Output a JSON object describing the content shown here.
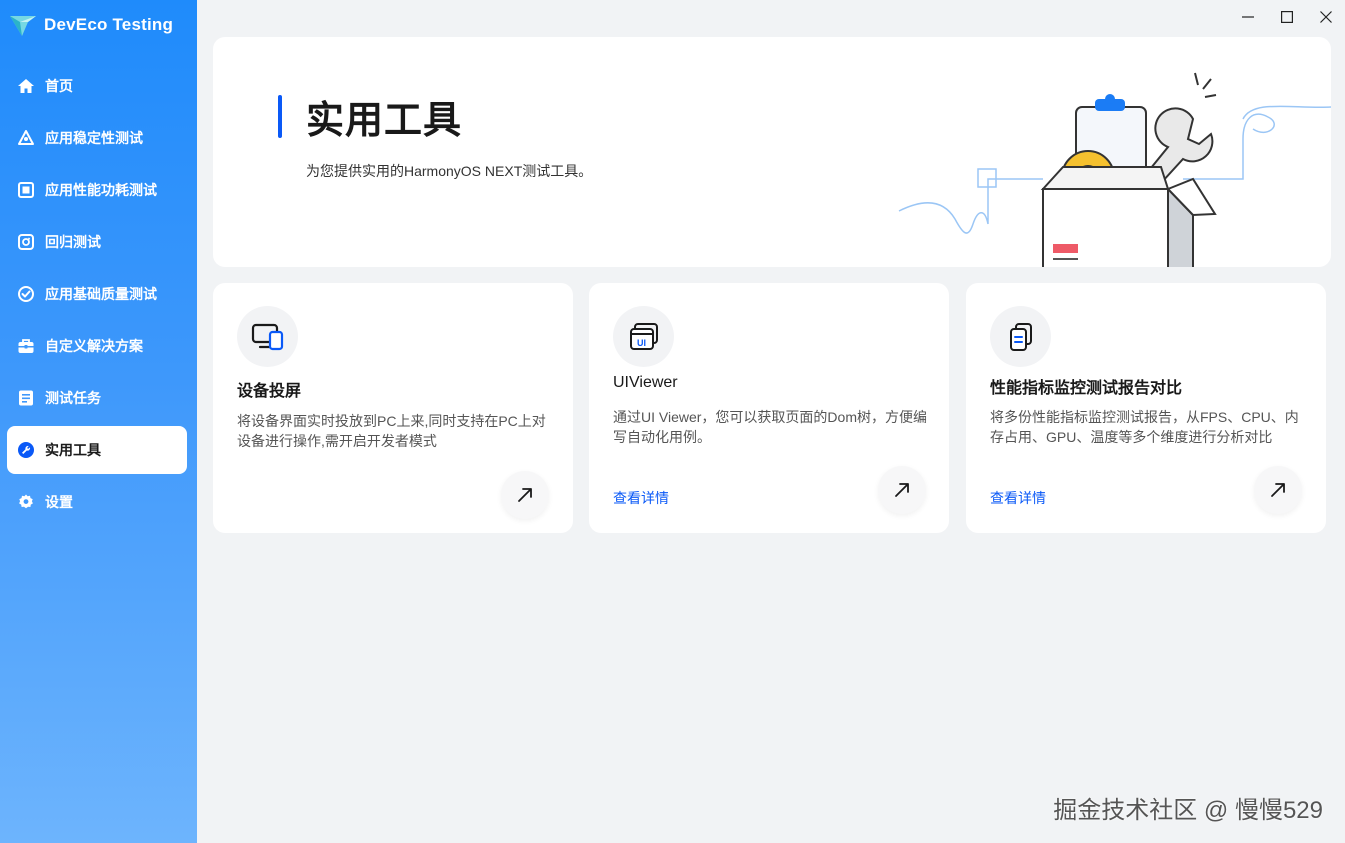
{
  "app": {
    "name": "DevEco Testing"
  },
  "sidebar": {
    "items": [
      {
        "label": "首页",
        "icon": "home-icon"
      },
      {
        "label": "应用稳定性测试",
        "icon": "stability-icon"
      },
      {
        "label": "应用性能功耗测试",
        "icon": "performance-icon"
      },
      {
        "label": "回归测试",
        "icon": "regression-icon"
      },
      {
        "label": "应用基础质量测试",
        "icon": "quality-check-icon"
      },
      {
        "label": "自定义解决方案",
        "icon": "toolbox-icon"
      },
      {
        "label": "测试任务",
        "icon": "task-list-icon"
      },
      {
        "label": "实用工具",
        "icon": "wrench-icon",
        "active": true
      },
      {
        "label": "设置",
        "icon": "gear-icon"
      }
    ]
  },
  "banner": {
    "title": "实用工具",
    "subtitle": "为您提供实用的HarmonyOS NEXT测试工具。"
  },
  "cards": [
    {
      "title": "设备投屏",
      "description": "将设备界面实时投放到PC上来,同时支持在PC上对设备进行操作,需开启开发者模式",
      "icon": "screen-mirror-icon",
      "link": ""
    },
    {
      "title": "UIViewer",
      "description": "通过UI Viewer，您可以获取页面的Dom树，方便编写自动化用例。",
      "icon": "ui-viewer-icon",
      "link": "查看详情"
    },
    {
      "title": "性能指标监控测试报告对比",
      "description": "将多份性能指标监控测试报告，从FPS、CPU、内存占用、GPU、温度等多个维度进行分析对比",
      "icon": "report-compare-icon",
      "link": "查看详情"
    }
  ],
  "watermark": "掘金技术社区 @ 慢慢529",
  "colors": {
    "sidebar_top": "#1f8bfb",
    "sidebar_bottom": "#6db4fd",
    "accent": "#0a59f7",
    "background": "#f1f3f5"
  }
}
